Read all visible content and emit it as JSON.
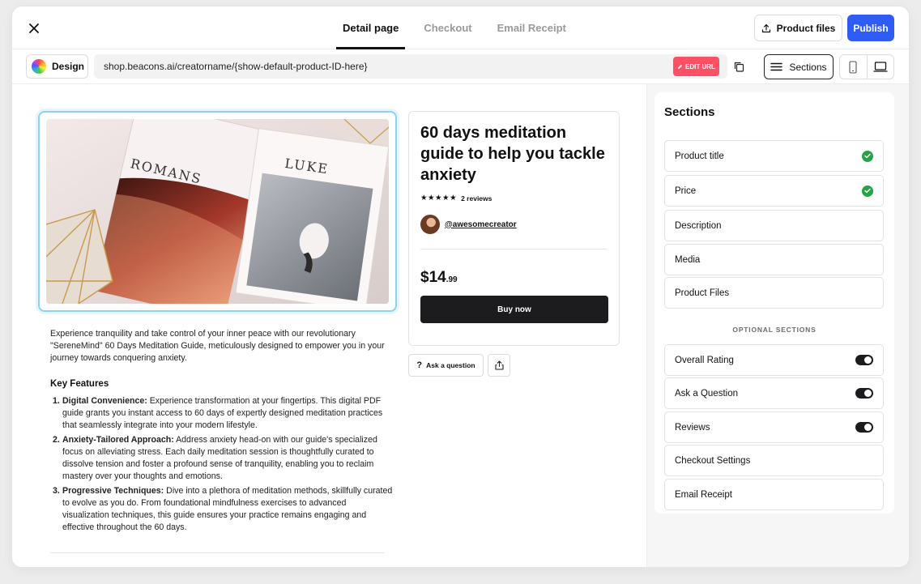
{
  "tabs": [
    "Detail page",
    "Checkout",
    "Email Receipt"
  ],
  "active_tab": "Detail page",
  "header": {
    "product_files_label": "Product files",
    "publish_label": "Publish"
  },
  "toolbar": {
    "design_label": "Design",
    "url": "shop.beacons.ai/creatorname/{show-default-product-ID-here}",
    "edit_url_label": "EDIT URL",
    "sections_label": "Sections"
  },
  "product": {
    "title": "60 days meditation guide to help you tackle anxiety",
    "stars": "★★★★★",
    "reviews": "2 reviews",
    "creator": "@awesomecreator",
    "price_main": "$14",
    "price_cents": ".99",
    "buy_label": "Buy now",
    "ask_label": "Ask a question",
    "book_left_title": "ROMANS",
    "book_right_title": "LUKE",
    "description": "Experience tranquility and take control of your inner peace with our revolutionary \"SereneMind\" 60 Days Meditation Guide, meticulously designed to empower you in your journey towards conquering anxiety.",
    "key_features_title": "Key Features",
    "features": [
      {
        "num": "1.",
        "title": "Digital Convenience:",
        "text": " Experience transformation at your fingertips. This digital PDF guide grants you instant access to 60 days of expertly designed meditation practices that seamlessly integrate into your modern lifestyle."
      },
      {
        "num": "2.",
        "title": "Anxiety-Tailored Approach:",
        "text": " Address anxiety head-on with our guide's specialized focus on alleviating stress. Each daily meditation session is thoughtfully curated to dissolve tension and foster a profound sense of tranquility, enabling you to reclaim mastery over your thoughts and emotions."
      },
      {
        "num": "3.",
        "title": "Progressive Techniques:",
        "text": " Dive into a plethora of meditation methods, skillfully curated to evolve as you do. From foundational mindfulness exercises to advanced visualization techniques, this guide ensures your practice remains engaging and effective throughout the 60 days."
      }
    ]
  },
  "sidebar": {
    "title": "Sections",
    "required": [
      {
        "label": "Product title",
        "checked": true
      },
      {
        "label": "Price",
        "checked": true
      },
      {
        "label": "Description",
        "checked": false
      },
      {
        "label": "Media",
        "checked": false
      },
      {
        "label": "Product Files",
        "checked": false
      }
    ],
    "optional_label": "OPTIONAL SECTIONS",
    "optional": [
      {
        "label": "Overall Rating",
        "toggle": true
      },
      {
        "label": "Ask a Question",
        "toggle": true
      },
      {
        "label": "Reviews",
        "toggle": true
      },
      {
        "label": "Checkout Settings",
        "toggle": false
      },
      {
        "label": "Email Receipt",
        "toggle": false
      }
    ]
  },
  "colors": {
    "accent": "#2f5cf5",
    "edit_url": "#ff4f64",
    "check": "#22a447",
    "dark": "#1c1c1f"
  }
}
